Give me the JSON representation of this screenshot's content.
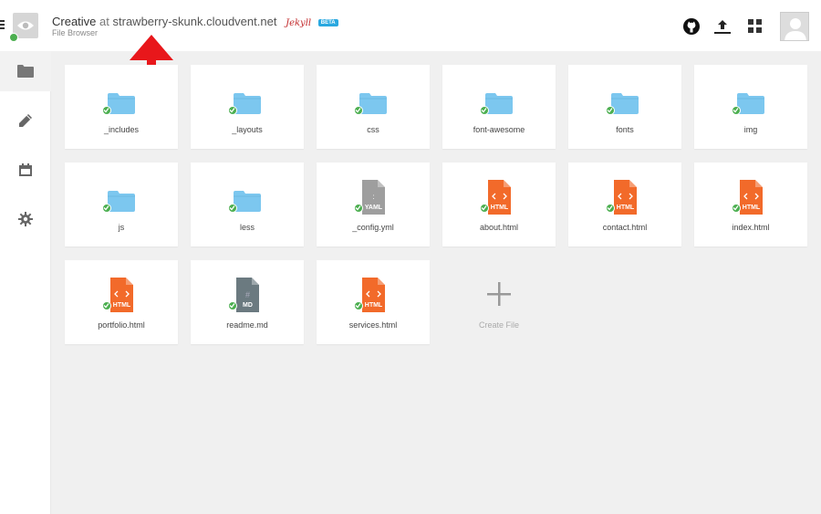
{
  "header": {
    "site_name": "Creative",
    "at_text": "at",
    "domain": "strawberry-skunk.cloudvent.net",
    "generator_logo_text": "Jekyll",
    "beta_label": "BETA",
    "subtitle": "File Browser"
  },
  "colors": {
    "folder": "#7cc7ef",
    "html": "#f26a2a",
    "yaml": "#9e9e9e",
    "md": "#6b7a80",
    "success": "#4caf50",
    "arrow": "#e8171b"
  },
  "sidebar": {
    "items": [
      {
        "icon": "folder-icon",
        "active": true
      },
      {
        "icon": "pencil-icon",
        "active": false
      },
      {
        "icon": "calendar-icon",
        "active": false
      },
      {
        "icon": "gear-icon",
        "active": false
      }
    ]
  },
  "files": [
    {
      "name": "_includes",
      "type": "folder",
      "badge": ""
    },
    {
      "name": "_layouts",
      "type": "folder",
      "badge": ""
    },
    {
      "name": "css",
      "type": "folder",
      "badge": ""
    },
    {
      "name": "font-awesome",
      "type": "folder",
      "badge": ""
    },
    {
      "name": "fonts",
      "type": "folder",
      "badge": ""
    },
    {
      "name": "img",
      "type": "folder",
      "badge": ""
    },
    {
      "name": "js",
      "type": "folder",
      "badge": ""
    },
    {
      "name": "less",
      "type": "folder",
      "badge": ""
    },
    {
      "name": "_config.yml",
      "type": "yaml",
      "badge": "YAML"
    },
    {
      "name": "about.html",
      "type": "html",
      "badge": "HTML"
    },
    {
      "name": "contact.html",
      "type": "html",
      "badge": "HTML"
    },
    {
      "name": "index.html",
      "type": "html",
      "badge": "HTML"
    },
    {
      "name": "portfolio.html",
      "type": "html",
      "badge": "HTML"
    },
    {
      "name": "readme.md",
      "type": "md",
      "badge": "MD"
    },
    {
      "name": "services.html",
      "type": "html",
      "badge": "HTML"
    }
  ],
  "create_file": {
    "label": "Create File",
    "icon": "plus-icon"
  }
}
